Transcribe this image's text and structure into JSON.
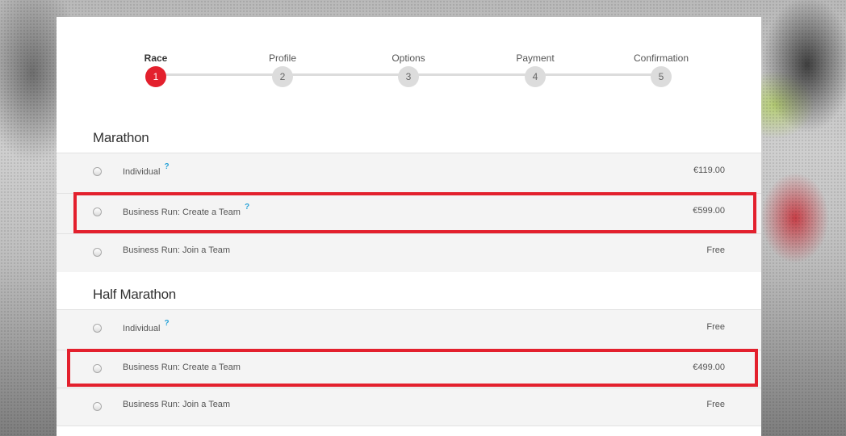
{
  "stepper": {
    "steps": [
      {
        "label": "Race",
        "number": "1",
        "active": true
      },
      {
        "label": "Profile",
        "number": "2",
        "active": false
      },
      {
        "label": "Options",
        "number": "3",
        "active": false
      },
      {
        "label": "Payment",
        "number": "4",
        "active": false
      },
      {
        "label": "Confirmation",
        "number": "5",
        "active": false
      }
    ]
  },
  "sections": [
    {
      "title": "Marathon",
      "options": [
        {
          "label": "Individual",
          "help": "?",
          "price": "€119.00",
          "highlighted": false
        },
        {
          "label": "Business Run: Create a Team",
          "help": "?",
          "price": "€599.00",
          "highlighted": true
        },
        {
          "label": "Business Run: Join a Team",
          "help": "",
          "price": "Free",
          "highlighted": false
        }
      ]
    },
    {
      "title": "Half Marathon",
      "options": [
        {
          "label": "Individual",
          "help": "?",
          "price": "Free",
          "highlighted": false
        },
        {
          "label": "Business Run: Create a Team",
          "help": "",
          "price": "€499.00",
          "highlighted": true
        },
        {
          "label": "Business Run: Join a Team",
          "help": "",
          "price": "Free",
          "highlighted": false
        }
      ]
    }
  ],
  "colors": {
    "accent": "#e3202d",
    "help": "#2aa3d8",
    "row_bg": "#f4f4f4"
  }
}
